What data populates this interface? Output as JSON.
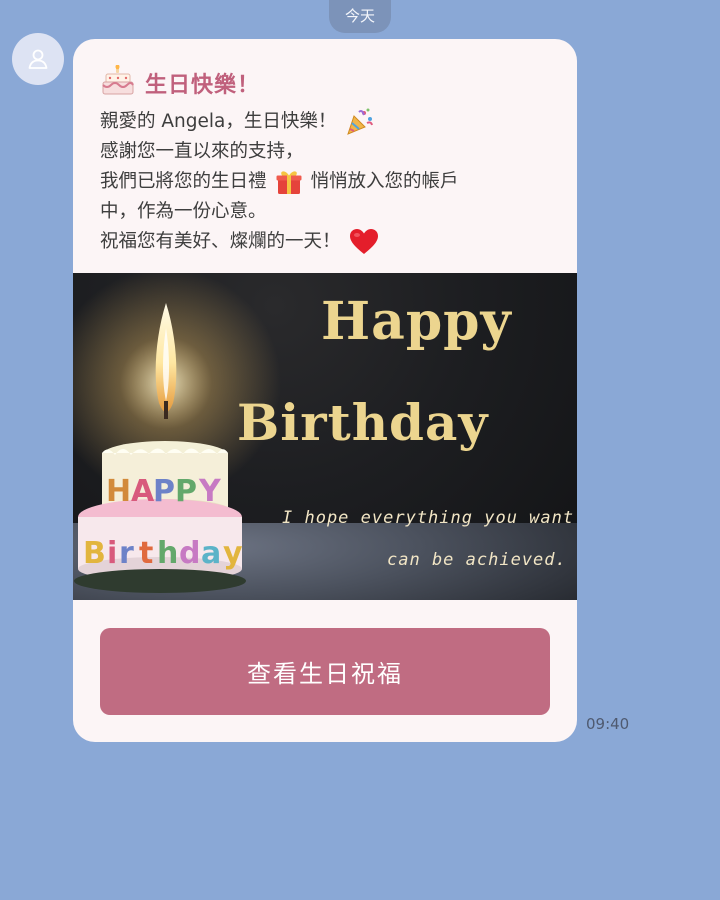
{
  "chat": {
    "date_label": "今天",
    "time": "09:40"
  },
  "message": {
    "title": "生日快樂！",
    "lines": [
      "親愛的 Angela，生日快樂！",
      "感謝您一直以來的支持，",
      "我們已將您的生日禮",
      "悄悄放入您的帳戶",
      "中，作為一份心意。",
      "祝福您有美好、燦爛的一天！"
    ],
    "icons": {
      "title": "birthday-cake-icon",
      "line1": "party-popper-icon",
      "line3": "gift-icon",
      "line5": "red-heart-icon"
    }
  },
  "banner": {
    "happy": "Happy",
    "birthday": "Birthday",
    "wish_line1": "I hope everything you want",
    "wish_line2": "can be achieved.",
    "candle_text_top": "HAPPY",
    "candle_text_bottom": "Birthday"
  },
  "cta": {
    "label": "查看生日祝福"
  },
  "colors": {
    "background": "#8aa8d6",
    "title": "#c0607c",
    "button": "#c06c82",
    "banner_text": "#ecd58f"
  }
}
